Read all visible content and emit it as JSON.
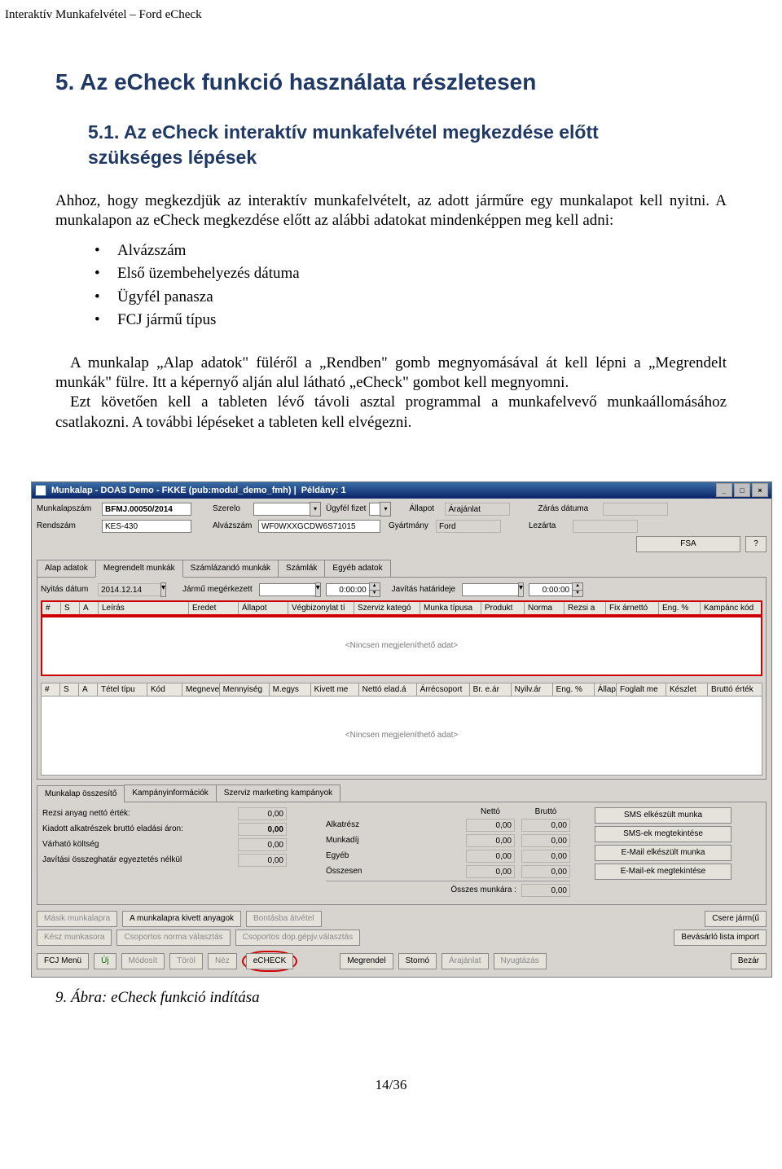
{
  "doc": {
    "running_header": "Interaktív Munkafelvétel – Ford eCheck",
    "section_title": "5. Az eCheck funkció használata részletesen",
    "subsection_title": "5.1.  Az eCheck interaktív munkafelvétel megkezdése előtt szükséges lépések",
    "p1": "Ahhoz, hogy megkezdjük az interaktív munkafelvételt, az adott járműre egy munkalapot kell nyitni. A munkalapon az eCheck megkezdése előtt az alábbi adatokat mindenképpen meg kell adni:",
    "bullets": [
      "Alvázszám",
      "Első üzembehelyezés dátuma",
      "Ügyfél panasza",
      "FCJ jármű típus"
    ],
    "p2": "A munkalap „Alap adatok\" füléről a „Rendben\" gomb megnyomásával át kell lépni a „Megrendelt munkák\" fülre. Itt a képernyő alján alul látható „eCheck\" gombot kell megnyomni.",
    "p3": "Ezt követően kell a tableten lévő távoli asztal programmal a munkafelvevő munkaállomásához csatlakozni. A további lépéseket a tableten kell elvégezni.",
    "figure_caption": "9. Ábra: eCheck funkció indítása",
    "page_number": "14/36"
  },
  "app": {
    "titlebar": {
      "title_prefix": "Munkalap - DOAS Demo - FKKE (pub:modul_demo_fmh)  |",
      "title_peldany": "Példány: 1"
    },
    "winbtns": {
      "min": "_",
      "max": "□",
      "close": "×"
    },
    "header": {
      "labels": {
        "munkalapsz": "Munkalapszám",
        "szerelo": "Szerelo",
        "ugyfel_fizet": "Ügyfél fizet",
        "allapot": "Állapot",
        "arajanlat": "Árajánlat",
        "zaras": "Zárás dátuma",
        "rendszam": "Rendszám",
        "alvazszam": "Alvázszám",
        "gyartmany": "Gyártmány",
        "lezarta": "Lezárta",
        "fsa_btn": "FSA",
        "q_btn": "?"
      },
      "values": {
        "munkalapsz": "BFMJ.00050/2014",
        "rendszam": "KES-430",
        "alvazszam": "WF0WXXGCDW6S71015",
        "gyartmany": "Ford"
      }
    },
    "tabs": [
      "Alap adatok",
      "Megrendelt munkák",
      "Számlázandó munkák",
      "Számlák",
      "Egyéb adatok"
    ],
    "second_row": {
      "labels": {
        "nyitas": "Nyitás dátum",
        "jarmu": "Jármű megérkezett",
        "jav_hat": "Javítás határideje"
      },
      "values": {
        "nyitas": "2014.12.14",
        "ido1": "0:00:00",
        "ido2": "0:00:00"
      },
      "spinner_up": "▲",
      "spinner_down": "▼"
    },
    "table1": {
      "heads": [
        "#",
        "S",
        "A",
        "Leírás",
        "Eredet",
        "Állapot",
        "Végbizonylat tí",
        "Szerviz kategó",
        "Munka típusa",
        "Produkt",
        "Norma",
        "Rezsi a",
        "Fix árnettó",
        "Eng. %",
        "Kampánc kód"
      ],
      "empty": "<Nincsen megjeleníthető adat>"
    },
    "table2": {
      "heads": [
        "#",
        "S",
        "A",
        "Tétel típu",
        "Kód",
        "Megnevezés",
        "Mennyiség",
        "M.egys",
        "Kivett me",
        "Nettó elad.á",
        "Árrécsoport",
        "Br. e.ár",
        "Nyilv.ár",
        "Eng. %",
        "Állapot",
        "Foglalt me",
        "Készlet",
        "Bruttó érték"
      ],
      "empty": "<Nincsen megjeleníthető adat>"
    },
    "bottom_tabs": [
      "Munkalap összesítő",
      "Kampányinformációk",
      "Szerviz marketing kampányok"
    ],
    "totals": {
      "left_labels": [
        "Rezsi anyag nettó érték:",
        "Kiadott alkatrészek bruttó eladási áron:",
        "Várható költség",
        "Javítási összeghatár egyeztetés nélkül"
      ],
      "left_values": [
        "0,00",
        "0,00",
        "0,00",
        "0,00"
      ],
      "mid_header_netto": "Nettó",
      "mid_header_brutto": "Bruttó",
      "mid_labels": [
        "Alkatrész",
        "Munkadíj",
        "Egyéb",
        "Összesen"
      ],
      "mid_netto": [
        "0,00",
        "0,00",
        "0,00",
        "0,00"
      ],
      "mid_brutto": [
        "0,00",
        "0,00",
        "0,00",
        "0,00"
      ],
      "osszes_munk_label": "Összes munkára :",
      "osszes_munk_value": "0,00",
      "right_buttons": [
        "SMS elkészült munka",
        "SMS-ek megtekintése",
        "E-Mail elkészült munka",
        "E-Mail-ek megtekintése"
      ]
    },
    "actions_row1": {
      "masik_munkalapra": "Másik munkalapra",
      "kivett_anyagok": "A munkalapra kivett anyagok",
      "bontasba_atvetel": "Bontásba átvétel",
      "csoportos": "Csoportos norma választás",
      "csoportos_dop": "Csoportos dop.gépjv.választás",
      "bevasarlo": "Bevásárló lista import",
      "csere": "Csere járm(ű"
    },
    "actions_row2": {
      "fcj_menu": "FCJ Menü",
      "uj": "Új",
      "modosit": "Módosít",
      "torol": "Töröl",
      "nez": "Néz",
      "echeck": "eCHECK",
      "megrendel": "Megrendel",
      "storno": "Stornó",
      "arajanlat": "Árajánlat",
      "nyugtazas": "Nyugtázás",
      "bezar": "Bezár"
    }
  }
}
